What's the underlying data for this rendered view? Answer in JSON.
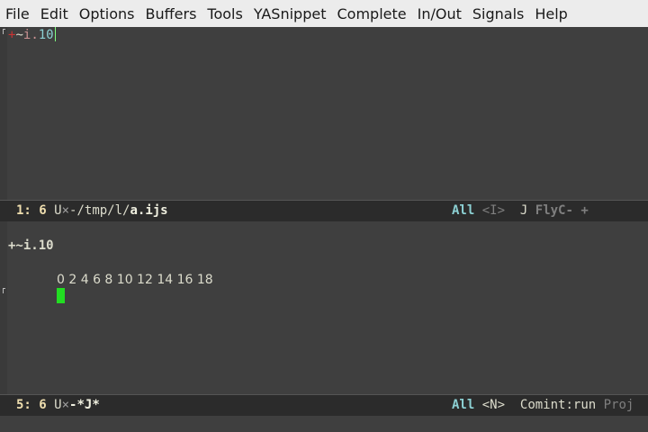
{
  "menu": {
    "items": [
      "File",
      "Edit",
      "Options",
      "Buffers",
      "Tools",
      "YASnippet",
      "Complete",
      "In/Out",
      "Signals",
      "Help"
    ]
  },
  "top_buffer": {
    "code": {
      "plus": "+",
      "tilde": "~",
      "i": "i",
      "dot": ".",
      "num": "10"
    }
  },
  "top_modeline": {
    "position": "1: 6",
    "encoding": "U",
    "modified_mark": "×",
    "path_prefix": "-/tmp/l/",
    "filename": "a.ijs",
    "scroll": "All",
    "state": "<I>",
    "major_mode": "J",
    "minor_modes": "FlyC- +"
  },
  "bottom_buffer": {
    "prompt": "+~i.10",
    "output": "0 2 4 6 8 10 12 14 16 18"
  },
  "bottom_modeline": {
    "position": "5: 6",
    "encoding": "U",
    "modified_mark": "×",
    "buffer_prefix": "-",
    "buffer_name": "*J*",
    "scroll": "All",
    "state": "<N>",
    "major_mode": "Comint:run",
    "minor_modes": "Proj"
  }
}
